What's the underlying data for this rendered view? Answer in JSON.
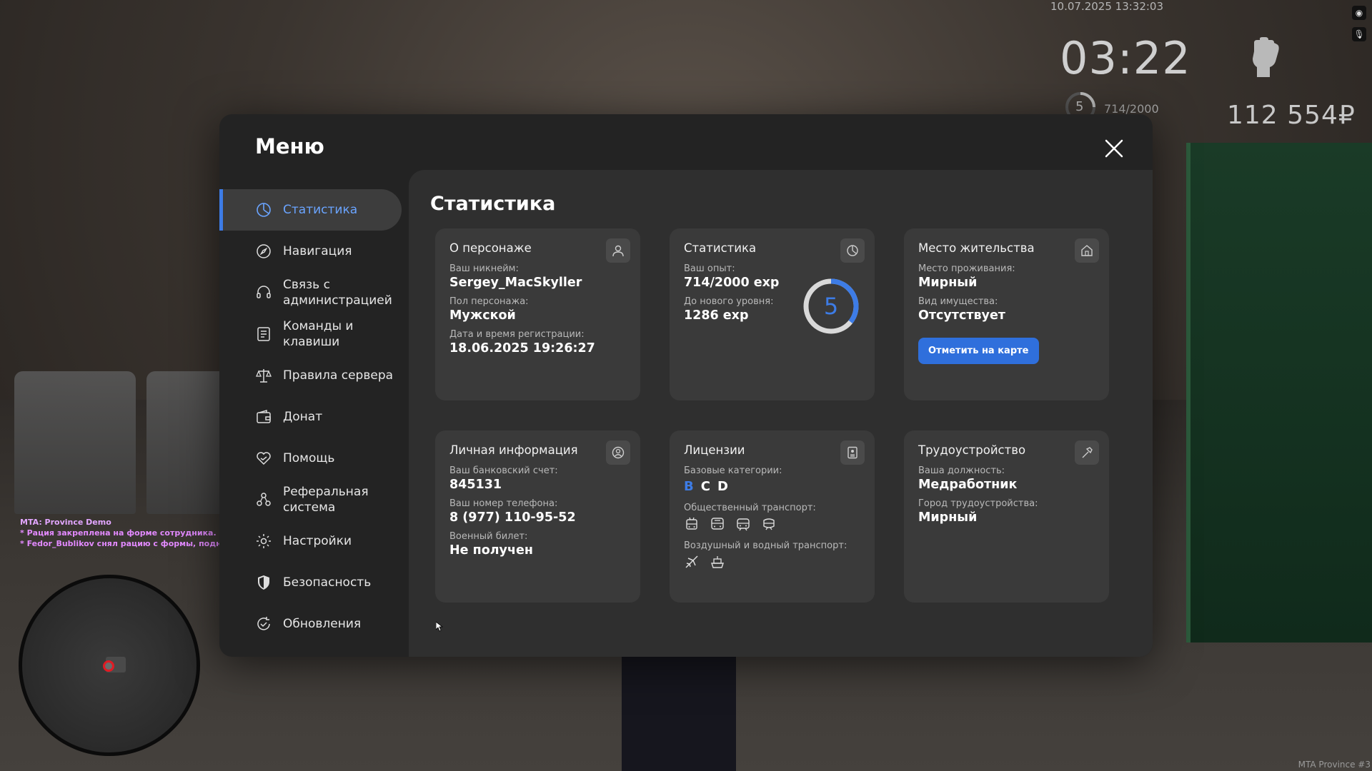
{
  "hud": {
    "date": "10.07.2025 13:32:03",
    "time": "03:22",
    "level": "5",
    "exp": "714/2000",
    "money": "112 554₽"
  },
  "chat": [
    "MTA: Province Demo",
    "* Рация закреплена на форме сотрудника. (Fedor_Bublikov)",
    "* Fedor_Bublikov снял рацию с формы, поднес её ко рту"
  ],
  "watermark": "MTA Province #3",
  "menu": {
    "title": "Меню",
    "nav": [
      {
        "label": "Статистика",
        "icon": "statistics-icon",
        "active": true
      },
      {
        "label": "Навигация",
        "icon": "compass-icon"
      },
      {
        "label": "Связь с администрацией",
        "icon": "headset-icon"
      },
      {
        "label": "Команды и клавиши",
        "icon": "keyboard-list-icon"
      },
      {
        "label": "Правила сервера",
        "icon": "scales-icon"
      },
      {
        "label": "Донат",
        "icon": "wallet-icon"
      },
      {
        "label": "Помощь",
        "icon": "help-heart-icon"
      },
      {
        "label": "Реферальная система",
        "icon": "referral-icon"
      },
      {
        "label": "Настройки",
        "icon": "gear-icon"
      },
      {
        "label": "Безопасность",
        "icon": "shield-icon"
      },
      {
        "label": "Обновления",
        "icon": "updates-icon"
      }
    ]
  },
  "content": {
    "title": "Статистика",
    "character": {
      "title": "О персонаже",
      "nick_label": "Ваш никнейм:",
      "nick": "Sergey_MacSkyller",
      "gender_label": "Пол персонажа:",
      "gender": "Мужской",
      "reg_label": "Дата и время регистрации:",
      "reg": "18.06.2025 19:26:27"
    },
    "stats": {
      "title": "Статистика",
      "exp_label": "Ваш опыт:",
      "exp": "714/2000 exp",
      "next_label": "До нового уровня:",
      "next": "1286 exp",
      "level": "5",
      "progress": 0.357
    },
    "residence": {
      "title": "Место жительства",
      "place_label": "Место проживания:",
      "place": "Мирный",
      "property_label": "Вид имущества:",
      "property": "Отсутствует",
      "button": "Отметить на карте"
    },
    "personal": {
      "title": "Личная информация",
      "bank_label": "Ваш банковский счет:",
      "bank": "845131",
      "phone_label": "Ваш номер телефона:",
      "phone": "8 (977) 110-95-52",
      "military_label": "Военный билет:",
      "military": "Не получен"
    },
    "licenses": {
      "title": "Лицензии",
      "base_label": "Базовые категории:",
      "cat_b": "B",
      "cat_c": "C",
      "cat_d": "D",
      "public_label": "Общественный транспорт:",
      "air_label": "Воздушный и водный транспорт:"
    },
    "job": {
      "title": "Трудоустройство",
      "position_label": "Ваша должность:",
      "position": "Медработник",
      "city_label": "Город трудоустройства:",
      "city": "Мирный"
    }
  },
  "colors": {
    "accent": "#3d7ce6",
    "panel": "#232323",
    "content": "#2f2f2f",
    "card": "#3a3a3a"
  }
}
